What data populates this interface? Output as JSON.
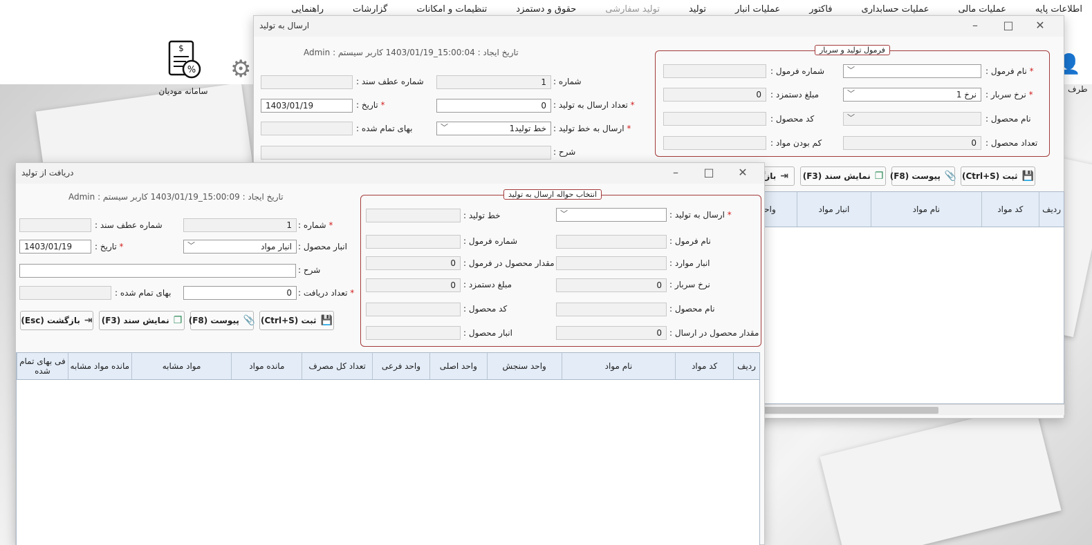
{
  "menu": [
    "اطلاعات پایه",
    "عملیات مالی",
    "عملیات حسابداری",
    "فاکتور",
    "عملیات انبار",
    "تولید",
    "تولید سفارشی",
    "حقوق و دستمزد",
    "تنظیمات و امکانات",
    "گزارشات",
    "راهنمایی"
  ],
  "header": {
    "taxpayer_label": "سامانه مودیان",
    "side_label": "طرف"
  },
  "send_window": {
    "title": "ارسال به تولید",
    "meta": "تاریخ ایجاد :  15:00:04_1403/01/19  کاربر سیستم : Admin",
    "labels": {
      "number": "شماره :",
      "ref_doc": "شماره عطف سند :",
      "send_count": "تعداد ارسال به تولید :",
      "date": "تاریخ :",
      "send_line": "ارسال به خط تولید :",
      "finished_price": "بهای تمام شده :",
      "description": "شرح :"
    },
    "values": {
      "number": "1",
      "send_count": "0",
      "date": "1403/01/19",
      "send_line": "خط تولید1"
    },
    "group": {
      "title": "فرمول تولید و سربار",
      "labels": {
        "formula_name": "نام فرمول :",
        "formula_number": "شماره فرمول :",
        "overhead_rate": "نرخ سربار :",
        "wage_amount": "مبلغ دستمزد :",
        "product_name": "نام محصول :",
        "product_code": "کد محصول :",
        "product_count": "تعداد محصول :",
        "material_shortage": "کم بودن مواد :"
      },
      "values": {
        "overhead_rate": "نرخ 1",
        "wage_amount": "0",
        "product_count": "0"
      }
    },
    "buttons": {
      "save": "ثبت (Ctrl+S)",
      "attach": "پیوست (F8)",
      "show_doc": "نمایش سند (F3)",
      "back": "بازگشت"
    },
    "grid_columns": [
      "ردیف",
      "کد مواد",
      "نام مواد",
      "انبار مواد",
      "واحد"
    ]
  },
  "receive_window": {
    "title": "دریافت از تولید",
    "meta": "تاریخ ایجاد :  15:00:09_1403/01/19  کاربر سیستم : Admin",
    "labels": {
      "number": "شماره :",
      "ref_doc": "شماره عطف سند :",
      "product_store": "انبار محصول :",
      "date": "تاریخ :",
      "description": "شرح :",
      "receive_count": "تعداد دریافت :",
      "finished_price": "بهای تمام شده :"
    },
    "values": {
      "number": "1",
      "product_store": "انبار مواد",
      "date": "1403/01/19",
      "receive_count": "0"
    },
    "group": {
      "title": "انتخاب حواله ارسال به تولید",
      "labels": {
        "send_to_production": "ارسال به تولید :",
        "production_line": "خط تولید :",
        "formula_name": "نام فرمول :",
        "formula_number": "شماره فرمول :",
        "material_store": "انبار موارد :",
        "qty_in_formula": "مقدار محصول در فرمول :",
        "overhead_rate": "نرخ سربار :",
        "wage_amount": "مبلغ دستمزد :",
        "product_name": "نام محصول :",
        "product_code": "کد محصول :",
        "qty_in_send": "مقدار محصول در ارسال :",
        "product_store": "انبار محصول :"
      },
      "values": {
        "qty_in_formula": "0",
        "overhead_rate": "0",
        "wage_amount": "0",
        "qty_in_send": "0"
      }
    },
    "buttons": {
      "save": "ثبت (Ctrl+S)",
      "attach": "پیوست (F8)",
      "show_doc": "نمایش سند (F3)",
      "back": "بازگشت (Esc)"
    },
    "grid_columns": [
      "ردیف",
      "کد مواد",
      "نام مواد",
      "واحد سنجش",
      "واحد اصلی",
      "واحد فرعی",
      "تعداد کل مصرف",
      "مانده مواد",
      "مواد مشابه",
      "مانده مواد مشابه",
      "فی بهای تمام شده"
    ]
  }
}
